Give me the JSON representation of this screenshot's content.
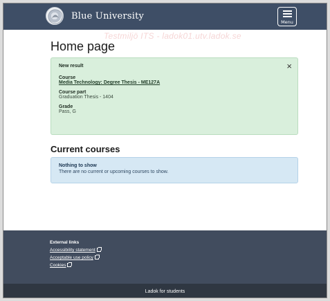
{
  "header": {
    "brand": "Blue University",
    "menu_label": "Menu"
  },
  "watermark": "Testmiljö ITS - ladok01.utv.ladok.se",
  "main": {
    "title": "Home page",
    "result": {
      "heading": "New result",
      "course_label": "Course",
      "course_value": "Media Technology: Degree Thesis - ME127A",
      "course_part_label": "Course part",
      "course_part_value": "Graduation Thesis - 1404",
      "grade_label": "Grade",
      "grade_value": "Pass, G",
      "close_glyph": "×"
    },
    "current_courses": {
      "title": "Current courses",
      "empty_title": "Nothing to show",
      "empty_text": "There are no current or upcoming courses to show."
    }
  },
  "footer": {
    "heading": "External links",
    "links": [
      {
        "label": "Accessibility statement"
      },
      {
        "label": "Acceptable use policy"
      },
      {
        "label": "Cookies"
      }
    ],
    "bottom_text": "Ladok for students"
  },
  "colors": {
    "header_bg": "#3e4e66",
    "success_bg": "#d9efdc",
    "info_bg": "#d6e8f4",
    "footer_bg": "#414c5e",
    "bottom_bg": "#2f3742"
  }
}
